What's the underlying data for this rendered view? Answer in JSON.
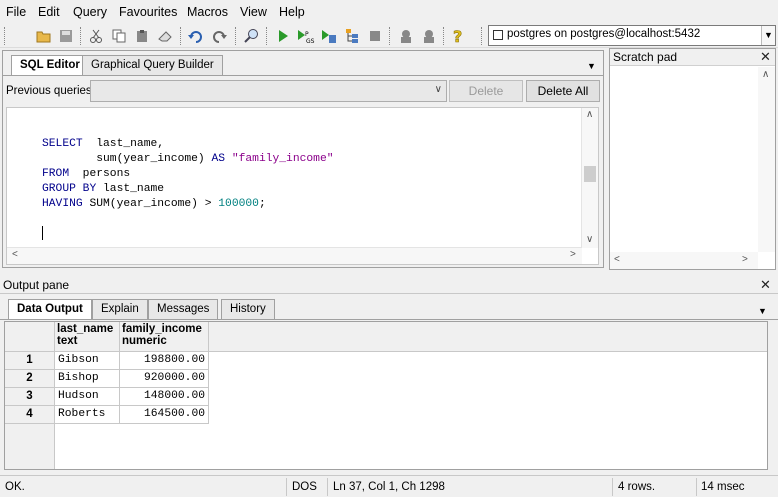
{
  "menu": [
    "File",
    "Edit",
    "Query",
    "Favourites",
    "Macros",
    "View",
    "Help"
  ],
  "connection": "postgres on postgres@localhost:5432",
  "editor_tabs": [
    "SQL Editor",
    "Graphical Query Builder"
  ],
  "previous_queries_label": "Previous queries",
  "delete_label": "Delete",
  "delete_all_label": "Delete All",
  "code_lines": [
    "SELECT  last_name,",
    "        sum(year_income) AS \"family_income\"",
    "FROM  persons",
    "GROUP BY last_name",
    "HAVING SUM(year_income) > 100000;"
  ],
  "scratch_title": "Scratch pad",
  "output_title": "Output pane",
  "output_tabs": [
    "Data Output",
    "Explain",
    "Messages",
    "History"
  ],
  "columns": [
    {
      "name": "last_name",
      "type": "text"
    },
    {
      "name": "family_income",
      "type": "numeric"
    }
  ],
  "rows": [
    {
      "n": "1",
      "last_name": "Gibson",
      "family_income": "198800.00"
    },
    {
      "n": "2",
      "last_name": "Bishop",
      "family_income": "920000.00"
    },
    {
      "n": "3",
      "last_name": "Hudson",
      "family_income": "148000.00"
    },
    {
      "n": "4",
      "last_name": "Roberts",
      "family_income": "164500.00"
    }
  ],
  "status": {
    "message": "OK.",
    "encoding": "DOS",
    "position": "Ln 37, Col 1, Ch 1298",
    "rows": "4 rows.",
    "time": "14 msec"
  },
  "colors": {
    "keyword": "#00008b",
    "string": "#8b008b",
    "number": "#008080"
  }
}
